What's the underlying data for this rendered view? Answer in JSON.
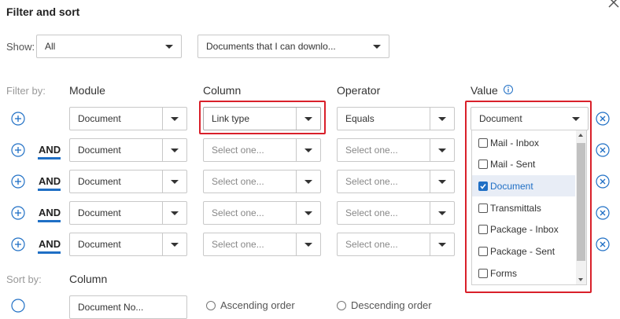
{
  "title": "Filter and sort",
  "show": {
    "label": "Show:",
    "value1": "All",
    "value2": "Documents that I can downlo..."
  },
  "headers": {
    "filter_by": "Filter by:",
    "module": "Module",
    "column": "Column",
    "operator": "Operator",
    "value": "Value"
  },
  "rows": [
    {
      "and": "",
      "module": "Document",
      "column": "Link type",
      "operator": "Equals",
      "value": "Document"
    },
    {
      "and": "AND",
      "module": "Document",
      "column": "Select one...",
      "operator": "Select one..."
    },
    {
      "and": "AND",
      "module": "Document",
      "column": "Select one...",
      "operator": "Select one..."
    },
    {
      "and": "AND",
      "module": "Document",
      "column": "Select one...",
      "operator": "Select one..."
    },
    {
      "and": "AND",
      "module": "Document",
      "column": "Select one...",
      "operator": "Select one..."
    }
  ],
  "value_options": [
    {
      "label": "Mail - Inbox",
      "checked": false
    },
    {
      "label": "Mail - Sent",
      "checked": false
    },
    {
      "label": "Document",
      "checked": true
    },
    {
      "label": "Transmittals",
      "checked": false
    },
    {
      "label": "Package - Inbox",
      "checked": false
    },
    {
      "label": "Package - Sent",
      "checked": false
    },
    {
      "label": "Forms",
      "checked": false
    }
  ],
  "sort": {
    "label": "Sort by:",
    "column_header": "Column",
    "value_partial": "Document No...",
    "asc_label": "Ascending order",
    "desc_label": "Descending order"
  },
  "colors": {
    "accent": "#1f6fc5",
    "highlight_border": "#d9202a"
  }
}
